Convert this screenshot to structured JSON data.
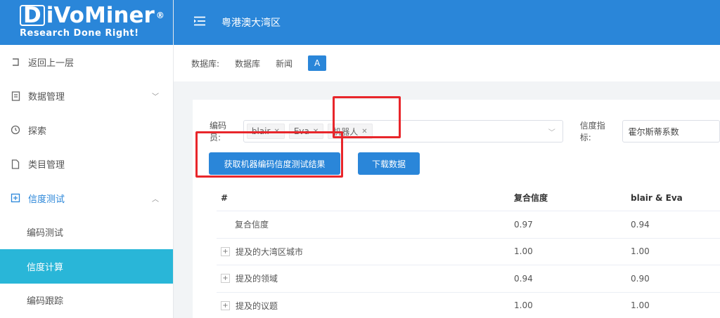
{
  "logo": {
    "brand_d": "D",
    "brand_rest": "iVoMiner",
    "reg": "®",
    "tagline": "Research Done Right!"
  },
  "header": {
    "title": "粤港澳大湾区"
  },
  "sidebar": {
    "items": [
      {
        "label": "返回上一层",
        "icon": "back-icon"
      },
      {
        "label": "数据管理",
        "icon": "document-icon"
      },
      {
        "label": "探索",
        "icon": "compass-icon"
      },
      {
        "label": "类目管理",
        "icon": "file-icon"
      },
      {
        "label": "信度测试",
        "icon": "reliability-icon"
      },
      {
        "label": "编码测试"
      },
      {
        "label": "信度计算"
      },
      {
        "label": "编码跟踪"
      }
    ]
  },
  "breadcrumb": {
    "label": "数据库:",
    "db": "数据库",
    "news": "新闻",
    "badge": "A"
  },
  "filters": {
    "coder_label": "编码员:",
    "coders": [
      "blair",
      "Eva",
      "机器人"
    ],
    "metric_label": "信度指标:",
    "metric_value": "霍尔斯蒂系数"
  },
  "buttons": {
    "get_result": "获取机器编码信度测试结果",
    "download": "下载数据"
  },
  "table": {
    "headers": [
      "#",
      "复合信度",
      "blair & Eva"
    ],
    "rows": [
      {
        "label": "复合信度",
        "composite": "0.97",
        "pair": "0.94",
        "expandable": false
      },
      {
        "label": "提及的大湾区城市",
        "composite": "1.00",
        "pair": "1.00",
        "expandable": true
      },
      {
        "label": "提及的领域",
        "composite": "0.94",
        "pair": "0.90",
        "expandable": true
      },
      {
        "label": "提及的议题",
        "composite": "1.00",
        "pair": "1.00",
        "expandable": true
      }
    ]
  },
  "colors": {
    "primary": "#2a86d9",
    "selected": "#29b6d8",
    "annotation": "#e8262b"
  }
}
